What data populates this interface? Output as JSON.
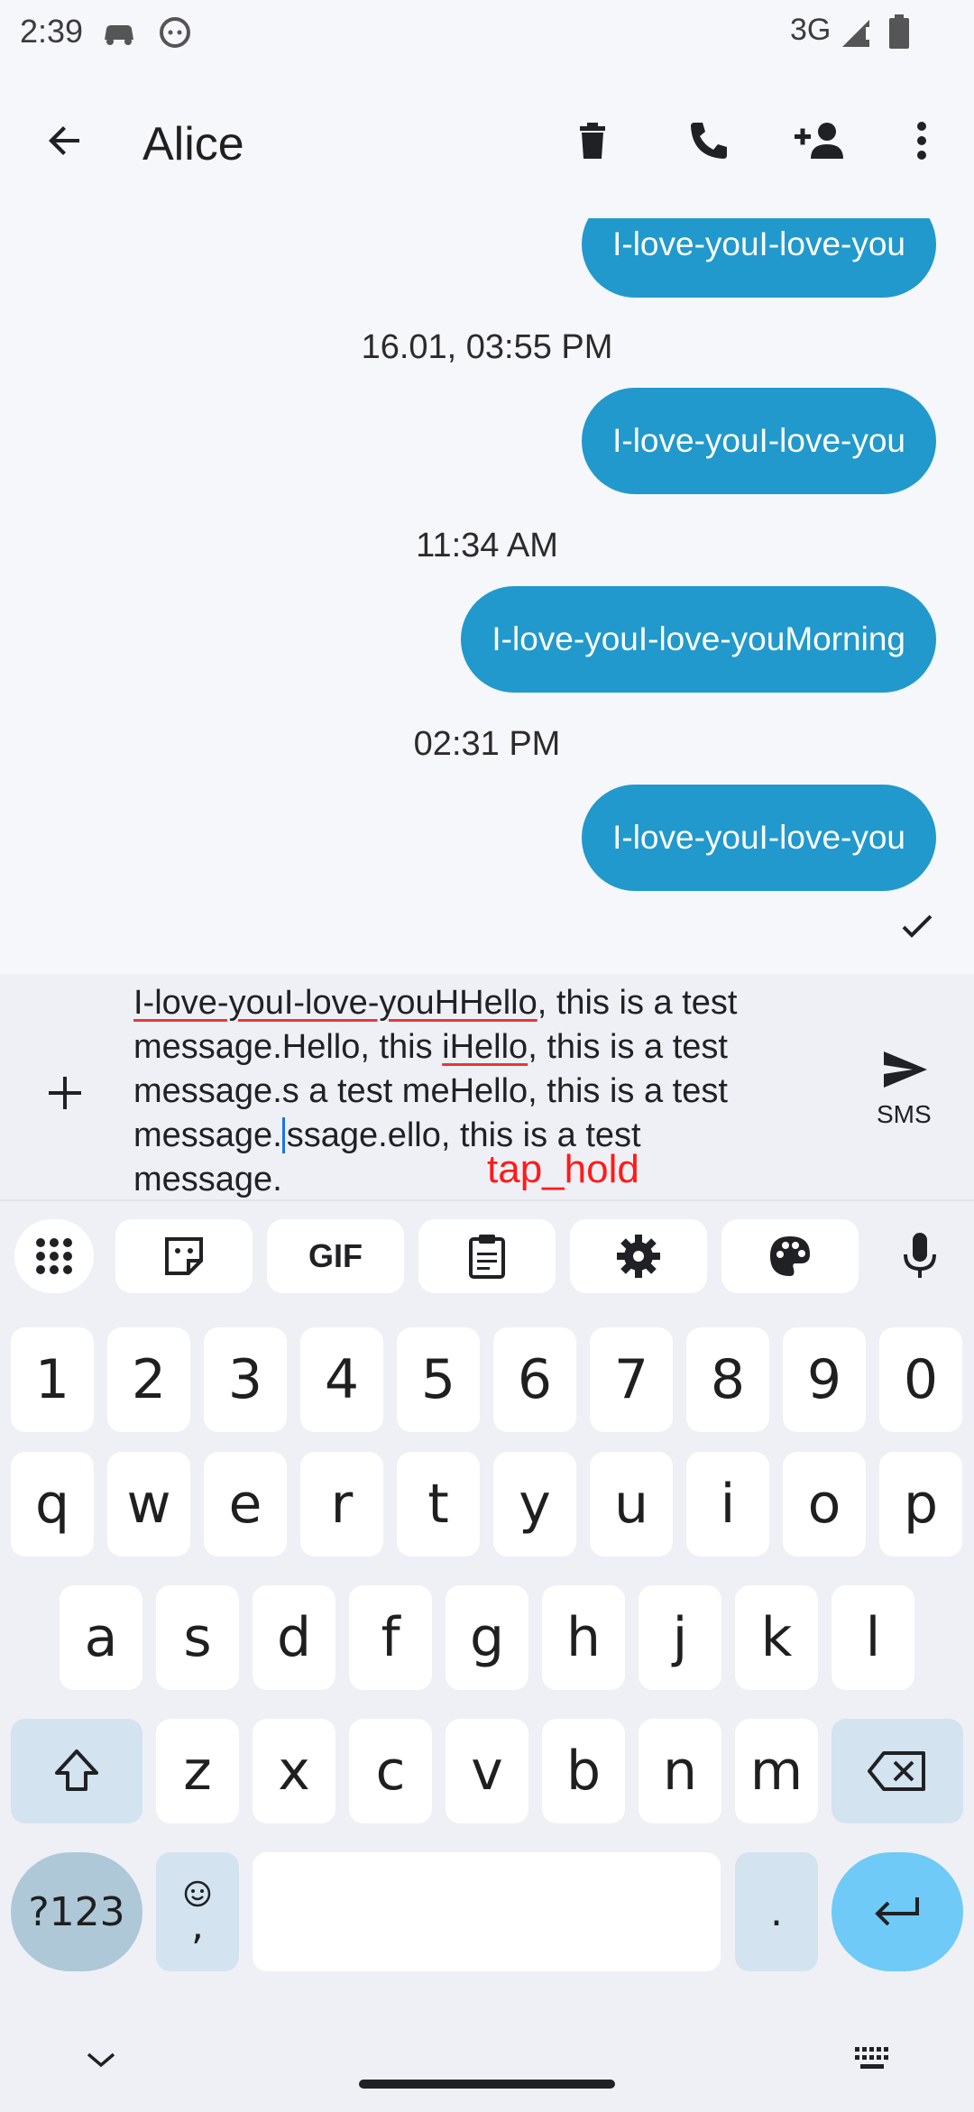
{
  "status_bar": {
    "time": "2:39",
    "network": "3G"
  },
  "toolbar": {
    "contact_name": "Alice",
    "icons": [
      "back-arrow-icon",
      "delete-icon",
      "phone-icon",
      "add-contact-icon",
      "more-vert-icon"
    ]
  },
  "chat": {
    "messages": [
      {
        "kind": "bubble",
        "text": "I-love-youI-love-you"
      },
      {
        "kind": "timestamp",
        "text": "16.01, 03:55 PM"
      },
      {
        "kind": "bubble",
        "text": "I-love-youI-love-you"
      },
      {
        "kind": "timestamp",
        "text": "11:34 AM"
      },
      {
        "kind": "bubble",
        "text": "I-love-youI-love-youMorning"
      },
      {
        "kind": "timestamp",
        "text": "02:31 PM"
      },
      {
        "kind": "bubble",
        "text": "I-love-youI-love-you"
      }
    ],
    "delivered_icon": "check-icon"
  },
  "composer": {
    "text_parts": {
      "p1": "I-love-youI-love-youHHello",
      "p2": ", this is a test\nmessage.Hello, this ",
      "p3": "iHello",
      "p4": ", this is a test\nmessage.s a test meHello, this is a test\nmessage.",
      "p5": "ssage.ello, this is a test\nmessage."
    },
    "send_label": "SMS",
    "overlay_label": "tap_hold"
  },
  "keyboard": {
    "toolbar_icons": [
      "apps-grid-icon",
      "sticker-icon",
      "gif-icon",
      "clipboard-icon",
      "settings-icon",
      "palette-icon",
      "mic-icon"
    ],
    "gif_label": "GIF",
    "row_numbers": [
      "1",
      "2",
      "3",
      "4",
      "5",
      "6",
      "7",
      "8",
      "9",
      "0"
    ],
    "row_q": [
      "q",
      "w",
      "e",
      "r",
      "t",
      "y",
      "u",
      "i",
      "o",
      "p"
    ],
    "row_a": [
      "a",
      "s",
      "d",
      "f",
      "g",
      "h",
      "j",
      "k",
      "l"
    ],
    "row_z": [
      "z",
      "x",
      "c",
      "v",
      "b",
      "n",
      "m"
    ],
    "sym_label": "?123",
    "comma_label": ",",
    "period_label": "."
  }
}
